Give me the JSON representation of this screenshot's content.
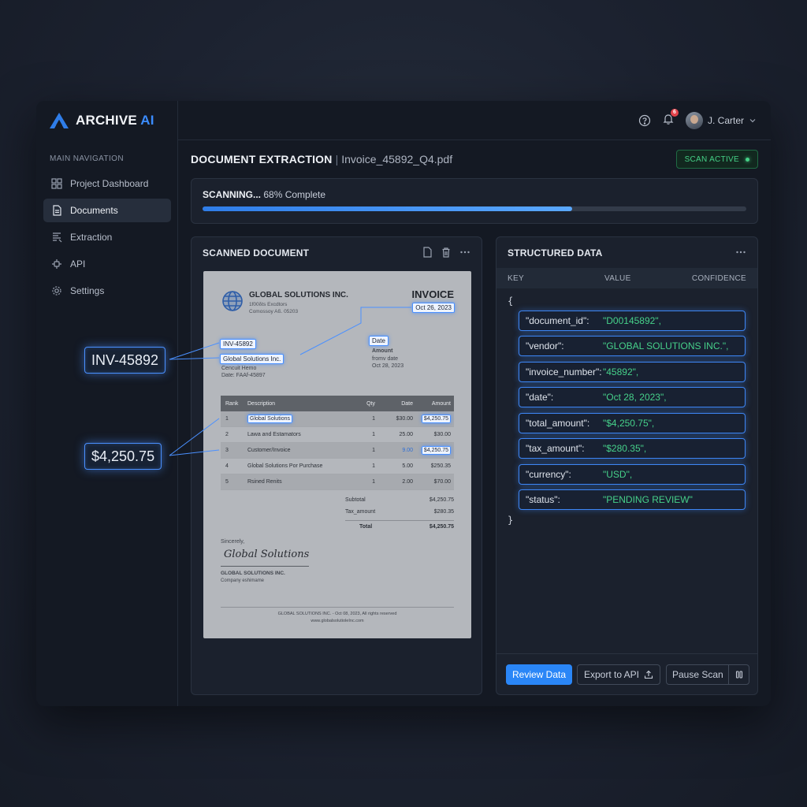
{
  "brand": {
    "name_main": "ARCHIVE",
    "name_accent": "AI"
  },
  "nav": {
    "title": "MAIN NAVIGATION",
    "items": [
      {
        "label": "Project Dashboard",
        "icon": "grid-icon"
      },
      {
        "label": "Documents",
        "icon": "document-icon",
        "active": true
      },
      {
        "label": "Extraction",
        "icon": "extraction-icon"
      },
      {
        "label": "API",
        "icon": "api-icon"
      },
      {
        "label": "Settings",
        "icon": "gear-icon"
      }
    ]
  },
  "topbar": {
    "notification_count": "6",
    "user_name": "J. Carter"
  },
  "header": {
    "title": "DOCUMENT EXTRACTION",
    "separator": "|",
    "file_name": "Invoice_45892_Q4.pdf",
    "status_badge": "SCAN ACTIVE"
  },
  "progress": {
    "status": "SCANNING...",
    "label": "68% Complete",
    "value": 0.68
  },
  "scanned_panel": {
    "title": "SCANNED DOCUMENT"
  },
  "document": {
    "company_name": "GLOBAL SOLUTIONS INC.",
    "address_line1": "1f00δts Εxcdtors",
    "address_line2": "Comossoy Aß. 05203",
    "title": "INVOICE",
    "date_highlight": "Oct 26, 2023",
    "invoice_highlight": "INV-45892",
    "vendor_highlight": "Global Solutions Inc.",
    "client_line1": "Cencuit Hemo",
    "client_line2": "Date: FAAf-45897",
    "date_label": "Date",
    "amount_label": "Amount",
    "from_date": "fromv date",
    "amount_date": "Oct 28, 2023",
    "table_headers": [
      "Rank",
      "Description",
      "Qty",
      "Date",
      "Amount"
    ],
    "rows": [
      {
        "rank": "1",
        "desc": "Global Solutions",
        "qty": "1",
        "date": "$30.00",
        "amount": "$4,250.75",
        "desc_hl": true,
        "amount_hl": true
      },
      {
        "rank": "2",
        "desc": "Lawa and Estamators",
        "qty": "1",
        "date": "25.00",
        "amount": "$30.00"
      },
      {
        "rank": "3",
        "desc": "Customer/Invoice",
        "qty": "1",
        "date": "9.00",
        "amount": "$4,250.75",
        "amount_hl": true
      },
      {
        "rank": "4",
        "desc": "Global Solutions Por Purchase",
        "qty": "1",
        "date": "5.00",
        "amount": "$250.35"
      },
      {
        "rank": "5",
        "desc": "Rsined Renits",
        "qty": "1",
        "date": "2.00",
        "amount": "$70.00"
      }
    ],
    "subtotal_label": "Subtotal",
    "subtotal_value": "$4,250.75",
    "tax_label": "Tax_amount",
    "tax_value": "$280.35",
    "total_label": "Total",
    "total_value": "$4,250.75",
    "closing": "Sincerely,",
    "signature": "Global Solutions",
    "sign_company": "GLOBAL SOLUTIONS INC.",
    "sign_title": "Company eshimame",
    "footer_line1": "GLOBAL SOLUTIONS INC. - Oct 08, 2023, All rights reserved",
    "footer_line2": "www.globalsolutioleInc.com"
  },
  "callouts": {
    "invoice": "INV-45892",
    "amount": "$4,250.75"
  },
  "structured_panel": {
    "title": "STRUCTURED DATA",
    "columns": [
      "KEY",
      "VALUE",
      "CONFIDENCE"
    ],
    "open_brace": "{",
    "close_brace": "}",
    "fields": [
      {
        "key": "\"document_id\":",
        "value": "\"D00145892\","
      },
      {
        "key": "\"vendor\":",
        "value": "\"GLOBAL SOLUTIONS INC.\","
      },
      {
        "key": "\"invoice_number\":",
        "value": "\"45892\","
      },
      {
        "key": "\"date\":",
        "value": "\"Oct 28, 2023\","
      },
      {
        "key": "\"total_amount\":",
        "value": "\"$4,250.75\","
      },
      {
        "key": "\"tax_amount\":",
        "value": "\"$280.35\","
      },
      {
        "key": "\"currency\":",
        "value": "\"USD\","
      },
      {
        "key": "\"status\":",
        "value": "\"PENDING REVIEW\""
      }
    ]
  },
  "actions": {
    "review": "Review Data",
    "export": "Export to API",
    "pause": "Pause Scan"
  },
  "colors": {
    "accent": "#2a86f7",
    "success": "#45d187",
    "highlight": "#4a90ff",
    "alert": "#e2434b"
  }
}
